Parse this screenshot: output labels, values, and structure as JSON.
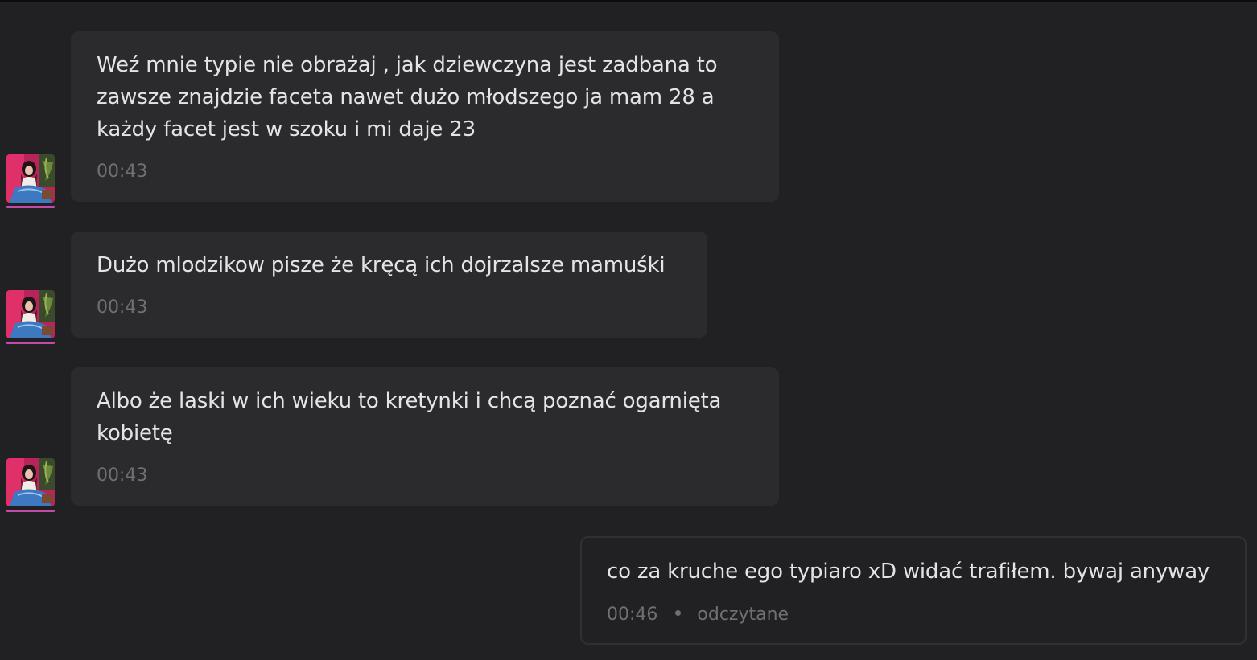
{
  "conversation": {
    "messages": [
      {
        "text": "Weź mnie typie nie obrażaj , jak dziewczyna jest zadbana to zawsze znajdzie faceta nawet dużo młodszego ja mam 28 a każdy facet jest w szoku i mi daje 23",
        "line1": "Weź mnie typie nie obrażaj , jak dziewczyna jest zadbana to",
        "line2": "zawsze znajdzie faceta nawet dużo młodszego ja mam 28 a",
        "line3": "każdy facet jest w szoku i mi daje 23",
        "time": "00:43"
      },
      {
        "text": "Dużo mlodzikow pisze że kręcą ich dojrzalsze mamuśki",
        "time": "00:43"
      },
      {
        "line1": "Albo że laski w ich wieku to kretynki i chcą poznać ogarnięta",
        "line2": "kobietę",
        "time": "00:43"
      }
    ],
    "own_message": {
      "text": "co za kruche ego typiaro xD widać trafiłem. bywaj anyway",
      "time": "00:46",
      "status": "odczytane"
    }
  },
  "colors": {
    "background": "#212123",
    "bubble": "#2b2b2d",
    "text": "#e4e4e6",
    "muted": "#707073",
    "avatar_underline": "#c24aa8"
  },
  "icons": {
    "avatar": "user-avatar-photo",
    "separator": "bullet-dot"
  }
}
